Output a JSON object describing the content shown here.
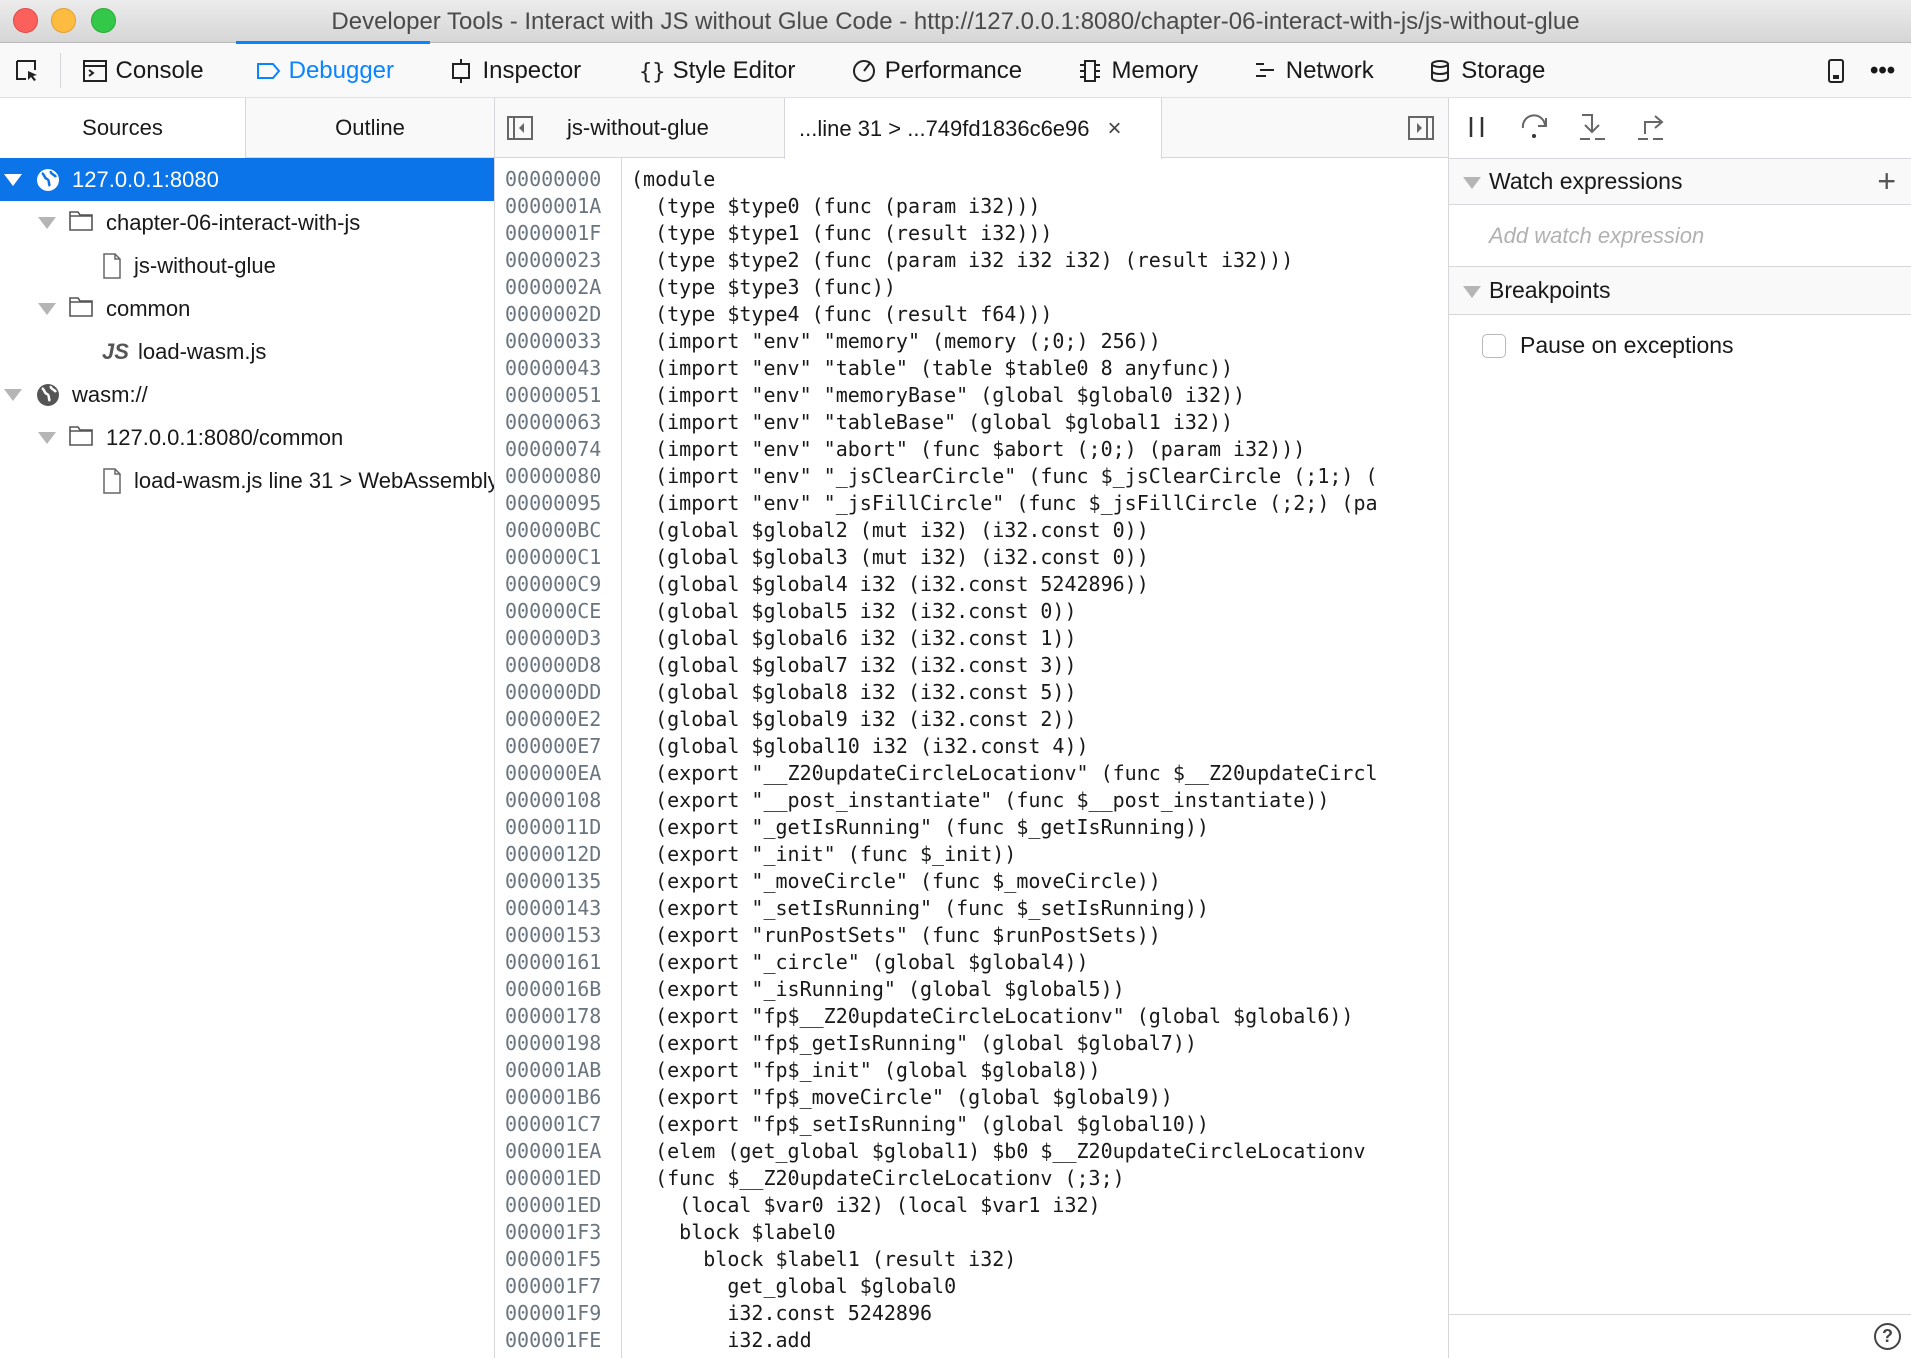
{
  "window": {
    "title": "Developer Tools - Interact with JS without Glue Code - http://127.0.0.1:8080/chapter-06-interact-with-js/js-without-glue"
  },
  "toolbar": {
    "tabs": [
      {
        "label": "Console",
        "icon": "console-icon"
      },
      {
        "label": "Debugger",
        "icon": "debugger-icon",
        "active": true
      },
      {
        "label": "Inspector",
        "icon": "inspector-icon"
      },
      {
        "label": "Style Editor",
        "icon": "braces-icon"
      },
      {
        "label": "Performance",
        "icon": "performance-icon"
      },
      {
        "label": "Memory",
        "icon": "memory-icon"
      },
      {
        "label": "Network",
        "icon": "network-icon"
      },
      {
        "label": "Storage",
        "icon": "storage-icon"
      }
    ],
    "accent": "#0a84ff"
  },
  "left": {
    "tabs": [
      "Sources",
      "Outline"
    ],
    "tree": [
      {
        "label": "127.0.0.1:8080",
        "icon": "globe-icon",
        "selected": true
      },
      {
        "label": "chapter-06-interact-with-js",
        "icon": "folder-icon"
      },
      {
        "label": "js-without-glue",
        "icon": "file-icon"
      },
      {
        "label": "common",
        "icon": "folder-icon"
      },
      {
        "label": "load-wasm.js",
        "icon": "js-icon",
        "icon_text": "JS"
      },
      {
        "label": "wasm://",
        "icon": "globe-icon"
      },
      {
        "label": "127.0.0.1:8080/common",
        "icon": "folder-icon"
      },
      {
        "label": "load-wasm.js line 31 > WebAssembly",
        "icon": "file-icon"
      }
    ]
  },
  "editor": {
    "tabs": [
      {
        "label": "js-without-glue"
      },
      {
        "label": "...line 31 > ...749fd1836c6e96",
        "active": true
      }
    ],
    "lines": [
      {
        "addr": "00000000",
        "text": "(module"
      },
      {
        "addr": "0000001A",
        "text": "  (type $type0 (func (param i32)))"
      },
      {
        "addr": "0000001F",
        "text": "  (type $type1 (func (result i32)))"
      },
      {
        "addr": "00000023",
        "text": "  (type $type2 (func (param i32 i32 i32) (result i32)))"
      },
      {
        "addr": "0000002A",
        "text": "  (type $type3 (func))"
      },
      {
        "addr": "0000002D",
        "text": "  (type $type4 (func (result f64)))"
      },
      {
        "addr": "00000033",
        "text": "  (import \"env\" \"memory\" (memory (;0;) 256))"
      },
      {
        "addr": "00000043",
        "text": "  (import \"env\" \"table\" (table $table0 8 anyfunc))"
      },
      {
        "addr": "00000051",
        "text": "  (import \"env\" \"memoryBase\" (global $global0 i32))"
      },
      {
        "addr": "00000063",
        "text": "  (import \"env\" \"tableBase\" (global $global1 i32))"
      },
      {
        "addr": "00000074",
        "text": "  (import \"env\" \"abort\" (func $abort (;0;) (param i32)))"
      },
      {
        "addr": "00000080",
        "text": "  (import \"env\" \"_jsClearCircle\" (func $_jsClearCircle (;1;) ("
      },
      {
        "addr": "00000095",
        "text": "  (import \"env\" \"_jsFillCircle\" (func $_jsFillCircle (;2;) (pa"
      },
      {
        "addr": "000000BC",
        "text": "  (global $global2 (mut i32) (i32.const 0))"
      },
      {
        "addr": "000000C1",
        "text": "  (global $global3 (mut i32) (i32.const 0))"
      },
      {
        "addr": "000000C9",
        "text": "  (global $global4 i32 (i32.const 5242896))"
      },
      {
        "addr": "000000CE",
        "text": "  (global $global5 i32 (i32.const 0))"
      },
      {
        "addr": "000000D3",
        "text": "  (global $global6 i32 (i32.const 1))"
      },
      {
        "addr": "000000D8",
        "text": "  (global $global7 i32 (i32.const 3))"
      },
      {
        "addr": "000000DD",
        "text": "  (global $global8 i32 (i32.const 5))"
      },
      {
        "addr": "000000E2",
        "text": "  (global $global9 i32 (i32.const 2))"
      },
      {
        "addr": "000000E7",
        "text": "  (global $global10 i32 (i32.const 4))"
      },
      {
        "addr": "000000EA",
        "text": "  (export \"__Z20updateCircleLocationv\" (func $__Z20updateCircl"
      },
      {
        "addr": "00000108",
        "text": "  (export \"__post_instantiate\" (func $__post_instantiate))"
      },
      {
        "addr": "0000011D",
        "text": "  (export \"_getIsRunning\" (func $_getIsRunning))"
      },
      {
        "addr": "0000012D",
        "text": "  (export \"_init\" (func $_init))"
      },
      {
        "addr": "00000135",
        "text": "  (export \"_moveCircle\" (func $_moveCircle))"
      },
      {
        "addr": "00000143",
        "text": "  (export \"_setIsRunning\" (func $_setIsRunning))"
      },
      {
        "addr": "00000153",
        "text": "  (export \"runPostSets\" (func $runPostSets))"
      },
      {
        "addr": "00000161",
        "text": "  (export \"_circle\" (global $global4))"
      },
      {
        "addr": "0000016B",
        "text": "  (export \"_isRunning\" (global $global5))"
      },
      {
        "addr": "00000178",
        "text": "  (export \"fp$__Z20updateCircleLocationv\" (global $global6))"
      },
      {
        "addr": "00000198",
        "text": "  (export \"fp$_getIsRunning\" (global $global7))"
      },
      {
        "addr": "000001AB",
        "text": "  (export \"fp$_init\" (global $global8))"
      },
      {
        "addr": "000001B6",
        "text": "  (export \"fp$_moveCircle\" (global $global9))"
      },
      {
        "addr": "000001C7",
        "text": "  (export \"fp$_setIsRunning\" (global $global10))"
      },
      {
        "addr": "000001EA",
        "text": "  (elem (get_global $global1) $b0 $__Z20updateCircleLocationv"
      },
      {
        "addr": "000001ED",
        "text": "  (func $__Z20updateCircleLocationv (;3;)"
      },
      {
        "addr": "000001ED",
        "text": "    (local $var0 i32) (local $var1 i32)"
      },
      {
        "addr": "000001F3",
        "text": "    block $label0"
      },
      {
        "addr": "000001F5",
        "text": "      block $label1 (result i32)"
      },
      {
        "addr": "000001F7",
        "text": "        get_global $global0"
      },
      {
        "addr": "000001F9",
        "text": "        i32.const 5242896"
      },
      {
        "addr": "000001FE",
        "text": "        i32.add"
      }
    ]
  },
  "right": {
    "watch_title": "Watch expressions",
    "watch_placeholder": "Add watch expression",
    "breakpoints_title": "Breakpoints",
    "pause_on_exceptions": "Pause on exceptions",
    "add_symbol": "+",
    "help_symbol": "?"
  }
}
